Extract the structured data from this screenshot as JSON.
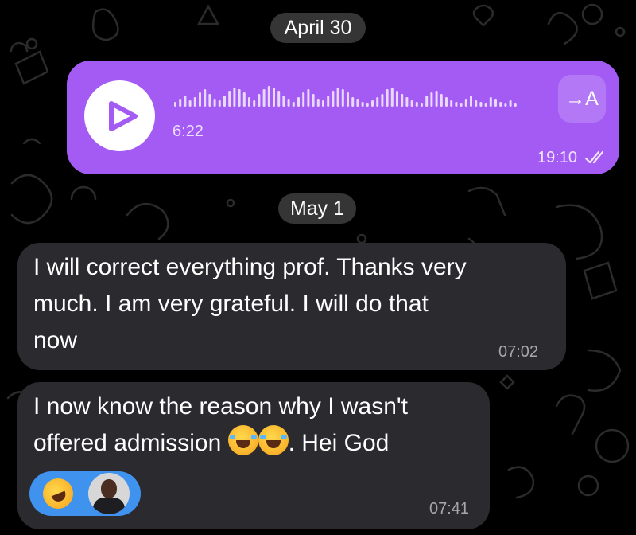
{
  "chat": {
    "date_separators": [
      "April 30",
      "May 1"
    ]
  },
  "voice_message": {
    "duration": "6:22",
    "transcribe_label": "→A",
    "time": "19:10",
    "status": "read",
    "bubble_color": "#a35bf3"
  },
  "messages": [
    {
      "text_lines": [
        "I will correct everything prof. Thanks very",
        "much. I am very grateful. I will do that",
        "now"
      ],
      "time": "07:02"
    },
    {
      "text_lines": [
        "I now know the reason why I wasn't",
        "offered admission",
        ". Hei God"
      ],
      "inline_emoji": [
        "😂",
        "😂"
      ],
      "time": "07:41",
      "reaction": {
        "emoji": "🤣",
        "color": "#3f92ee"
      }
    }
  ],
  "icons": [
    "play-icon",
    "waveform",
    "transcribe-icon",
    "double-check-icon",
    "laughing-emoji-icon",
    "reaction-emoji-icon",
    "avatar"
  ]
}
